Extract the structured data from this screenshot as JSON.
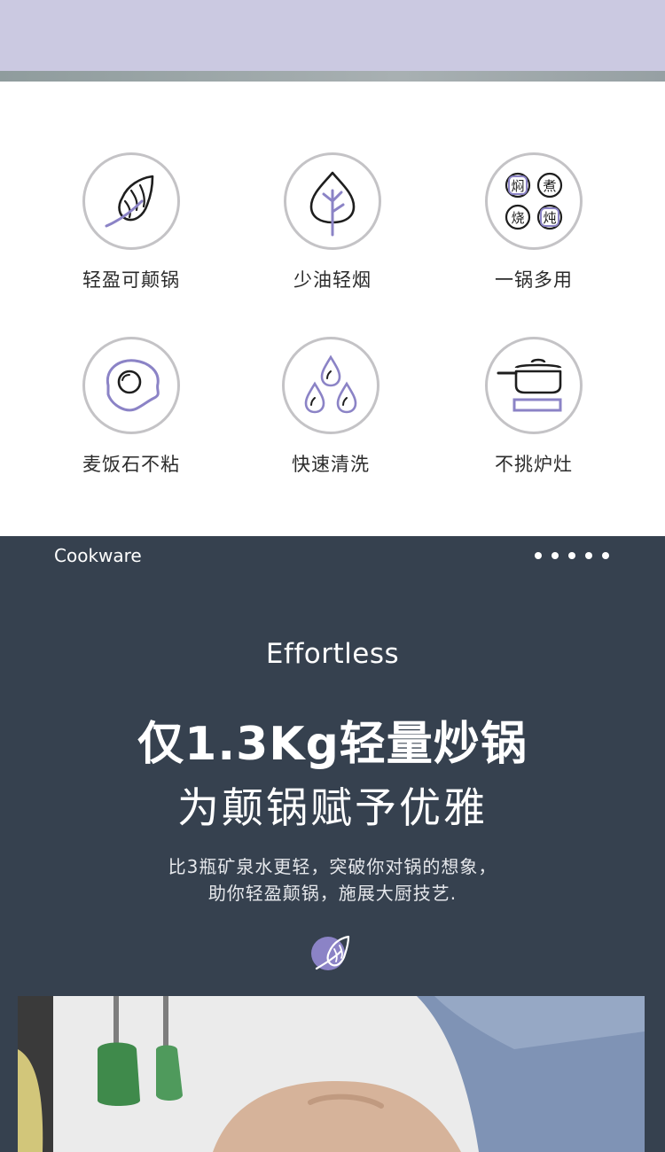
{
  "features": [
    {
      "label": "轻盈可颠锅",
      "icon": "leaf-feather-icon"
    },
    {
      "label": "少油轻烟",
      "icon": "leaf-drop-icon"
    },
    {
      "label": "一锅多用",
      "icon": "cooking-methods-icon",
      "chars": [
        "焖",
        "煮",
        "烧",
        "炖"
      ]
    },
    {
      "label": "麦饭石不粘",
      "icon": "fried-egg-icon"
    },
    {
      "label": "快速清洗",
      "icon": "water-drops-icon"
    },
    {
      "label": "不挑炉灶",
      "icon": "pot-on-stove-icon"
    }
  ],
  "banner": {
    "brand": "Cookware",
    "eyebrow": "Effortless",
    "headline": "仅1.3Kg轻量炒锅",
    "subhead": "为颠锅赋予优雅",
    "desc_line1": "比3瓶矿泉水更轻，突破你对锅的想象，",
    "desc_line2": "助你轻盈颠锅，施展大厨技艺.",
    "badge_icon": "feather-icon"
  },
  "colors": {
    "top_band": "#cbc9e1",
    "accent": "#8b83c6",
    "dark_panel": "#36414f"
  }
}
